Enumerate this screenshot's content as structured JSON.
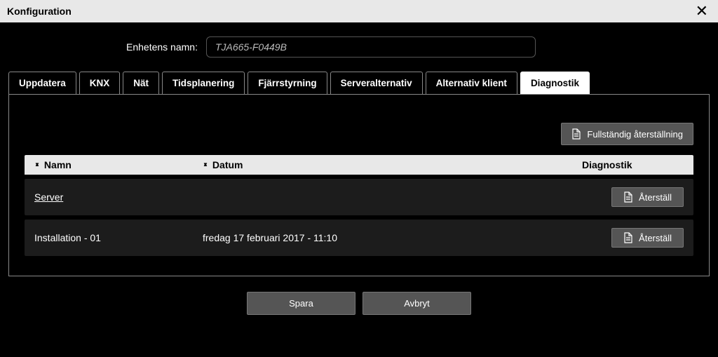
{
  "window": {
    "title": "Konfiguration"
  },
  "form": {
    "device_name_label": "Enhetens namn:",
    "device_name_value": "TJA665-F0449B"
  },
  "tabs": [
    {
      "label": "Uppdatera",
      "active": false
    },
    {
      "label": "KNX",
      "active": false
    },
    {
      "label": "Nät",
      "active": false
    },
    {
      "label": "Tidsplanering",
      "active": false
    },
    {
      "label": "Fjärrstyrning",
      "active": false
    },
    {
      "label": "Serveralternativ",
      "active": false
    },
    {
      "label": "Alternativ klient",
      "active": false
    },
    {
      "label": "Diagnostik",
      "active": true
    }
  ],
  "panel": {
    "full_reset_label": "Fullständig återställning",
    "columns": {
      "name": "Namn",
      "date": "Datum",
      "diag": "Diagnostik"
    },
    "rows": [
      {
        "name": "Server",
        "date": "",
        "link": true,
        "reset_label": "Återställ"
      },
      {
        "name": "Installation - 01",
        "date": "fredag 17 februari 2017 - 11:10",
        "link": false,
        "reset_label": "Återställ"
      }
    ]
  },
  "footer": {
    "save": "Spara",
    "cancel": "Avbryt"
  }
}
